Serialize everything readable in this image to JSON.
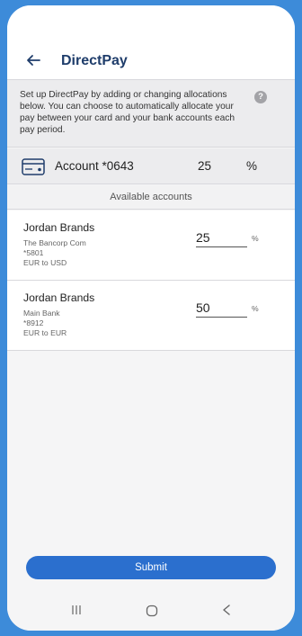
{
  "header": {
    "title": "DirectPay",
    "back_icon": "back-arrow-icon"
  },
  "intro": {
    "text": "Set up DirectPay by adding or changing allocations below. You can choose to automatically allocate your pay between your card and your bank accounts each pay period.",
    "help_icon": "help-icon",
    "help_glyph": "?"
  },
  "primary_account": {
    "icon": "card-icon",
    "label": "Account *0643",
    "value": "25",
    "unit": "%"
  },
  "available_header": "Available accounts",
  "accounts": [
    {
      "name": "Jordan Brands",
      "bank": "The Bancorp Com",
      "number": "*5801",
      "currency": "EUR to USD",
      "value": "25",
      "unit": "%"
    },
    {
      "name": "Jordan Brands",
      "bank": "Main Bank",
      "number": "*8912",
      "currency": "EUR to EUR",
      "value": "50",
      "unit": "%"
    }
  ],
  "submit_label": "Submit",
  "navbar": {
    "icons": [
      "recent-apps-icon",
      "home-icon",
      "back-icon"
    ]
  },
  "colors": {
    "brand": "#1f3d6b",
    "button": "#2b6fce",
    "frame": "#3d8bd9"
  }
}
